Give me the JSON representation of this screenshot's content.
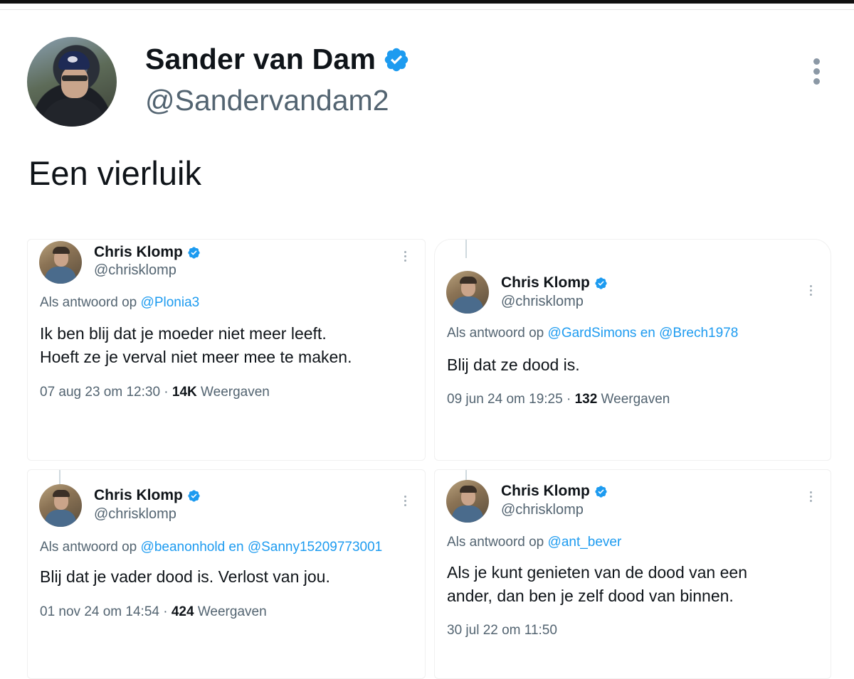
{
  "tweet": {
    "author_name": "Sander van Dam",
    "author_handle": "@Sandervandam2",
    "text": "Een vierluik"
  },
  "colors": {
    "verified": "#1d9bf0",
    "link": "#1d9bf0",
    "secondary_text": "#536471",
    "primary_text": "#0f1419"
  },
  "cards": [
    {
      "name": "Chris Klomp",
      "handle": "@chrisklomp",
      "reply_prefix": "Als antwoord op",
      "reply_to": "@Plonia3",
      "line1": "Ik ben blij dat je moeder niet meer leeft.",
      "line2": "Hoeft ze je verval niet meer mee te maken.",
      "date": "07 aug 23 om 12:30 · ",
      "views": "14K",
      "views_label": " Weergaven"
    },
    {
      "name": "Chris Klomp",
      "handle": "@chrisklomp",
      "reply_prefix": "Als antwoord op",
      "reply_to": "@GardSimons en @Brech1978",
      "line1": "Blij dat ze dood is.",
      "line2": "",
      "date": "09 jun 24 om 19:25 · ",
      "views": "132",
      "views_label": " Weergaven"
    },
    {
      "name": "Chris Klomp",
      "handle": "@chrisklomp",
      "reply_prefix": "Als antwoord op",
      "reply_to": "@beanonhold en @Sanny15209773001",
      "line1": "Blij dat je vader dood is. Verlost van jou.",
      "line2": "",
      "date": "01 nov 24 om 14:54 · ",
      "views": "424",
      "views_label": " Weergaven"
    },
    {
      "name": "Chris Klomp",
      "handle": "@chrisklomp",
      "reply_prefix": "Als antwoord op",
      "reply_to": "@ant_bever",
      "line1": "Als je kunt genieten van de dood van een",
      "line2": "ander, dan ben je zelf dood van binnen.",
      "date": "30 jul 22 om 11:50",
      "views": "",
      "views_label": ""
    }
  ]
}
